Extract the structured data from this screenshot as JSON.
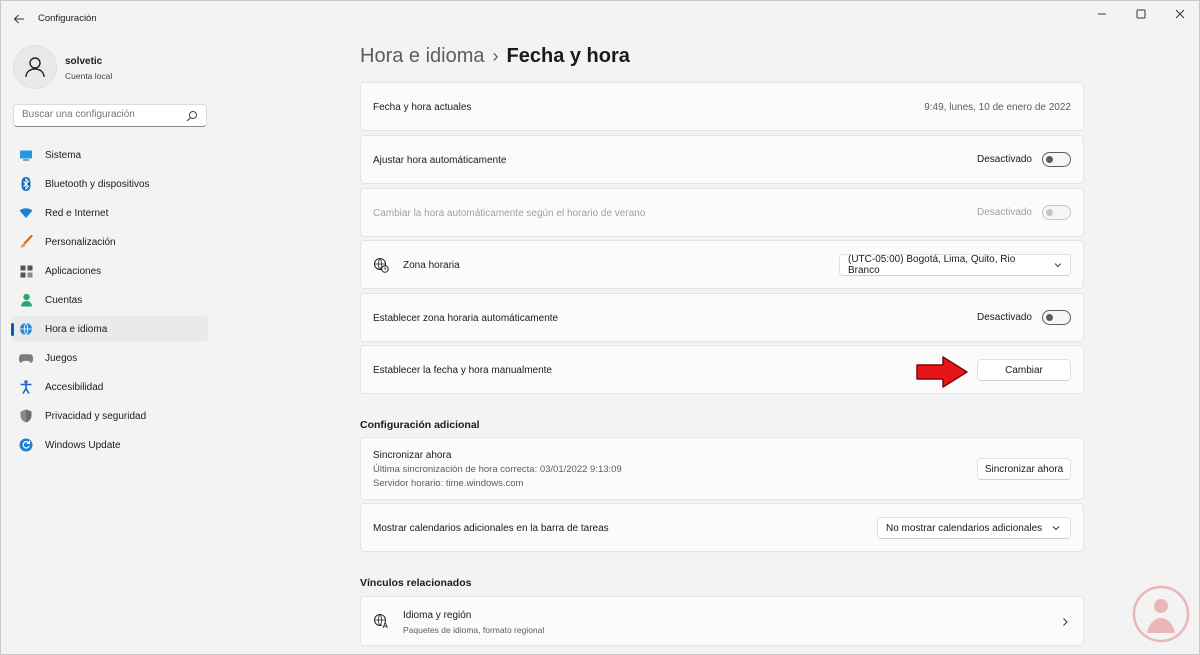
{
  "window": {
    "title": "Configuración",
    "back_icon": "back-arrow-icon",
    "controls": [
      "minimize-icon",
      "maximize-icon",
      "close-icon"
    ]
  },
  "profile": {
    "name": "solvetic",
    "account_type": "Cuenta local"
  },
  "search": {
    "placeholder": "Buscar una configuración"
  },
  "sidebar": {
    "items": [
      {
        "label": "Sistema",
        "icon": "monitor-icon"
      },
      {
        "label": "Bluetooth y dispositivos",
        "icon": "bluetooth-icon"
      },
      {
        "label": "Red e Internet",
        "icon": "wifi-icon"
      },
      {
        "label": "Personalización",
        "icon": "brush-icon"
      },
      {
        "label": "Aplicaciones",
        "icon": "apps-icon"
      },
      {
        "label": "Cuentas",
        "icon": "person-icon"
      },
      {
        "label": "Hora e idioma",
        "icon": "globe-clock-icon",
        "active": true
      },
      {
        "label": "Juegos",
        "icon": "gamepad-icon"
      },
      {
        "label": "Accesibilidad",
        "icon": "accessibility-icon"
      },
      {
        "label": "Privacidad y seguridad",
        "icon": "shield-icon"
      },
      {
        "label": "Windows Update",
        "icon": "update-icon"
      }
    ]
  },
  "breadcrumb": {
    "parent": "Hora e idioma",
    "separator": "›",
    "current": "Fecha y hora"
  },
  "settings": {
    "current_datetime": {
      "label": "Fecha y hora actuales",
      "value": "9:49, lunes, 10 de enero de 2022"
    },
    "auto_time": {
      "label": "Ajustar hora automáticamente",
      "state": "Desactivado"
    },
    "dst": {
      "label": "Cambiar la hora automáticamente según el horario de verano",
      "state": "Desactivado"
    },
    "timezone": {
      "label": "Zona horaria",
      "value": "(UTC-05:00) Bogotá, Lima, Quito, Rio Branco"
    },
    "auto_timezone": {
      "label": "Establecer zona horaria automáticamente",
      "state": "Desactivado"
    },
    "manual": {
      "label": "Establecer la fecha y hora manualmente",
      "button": "Cambiar"
    }
  },
  "additional": {
    "title": "Configuración adicional",
    "sync": {
      "title": "Sincronizar ahora",
      "last_sync": "Última sincronización de hora correcta: 03/01/2022 9:13:09",
      "server": "Servidor horario: time.windows.com",
      "button": "Sincronizar ahora"
    },
    "calendars": {
      "label": "Mostrar calendarios adicionales en la barra de tareas",
      "value": "No mostrar calendarios adicionales"
    }
  },
  "related": {
    "title": "Vínculos relacionados",
    "language": {
      "title": "Idioma y región",
      "subtitle": "Paquetes de idioma, formato regional"
    }
  },
  "colors": {
    "accent": "#005fb8",
    "arrow": "#e8141a"
  }
}
